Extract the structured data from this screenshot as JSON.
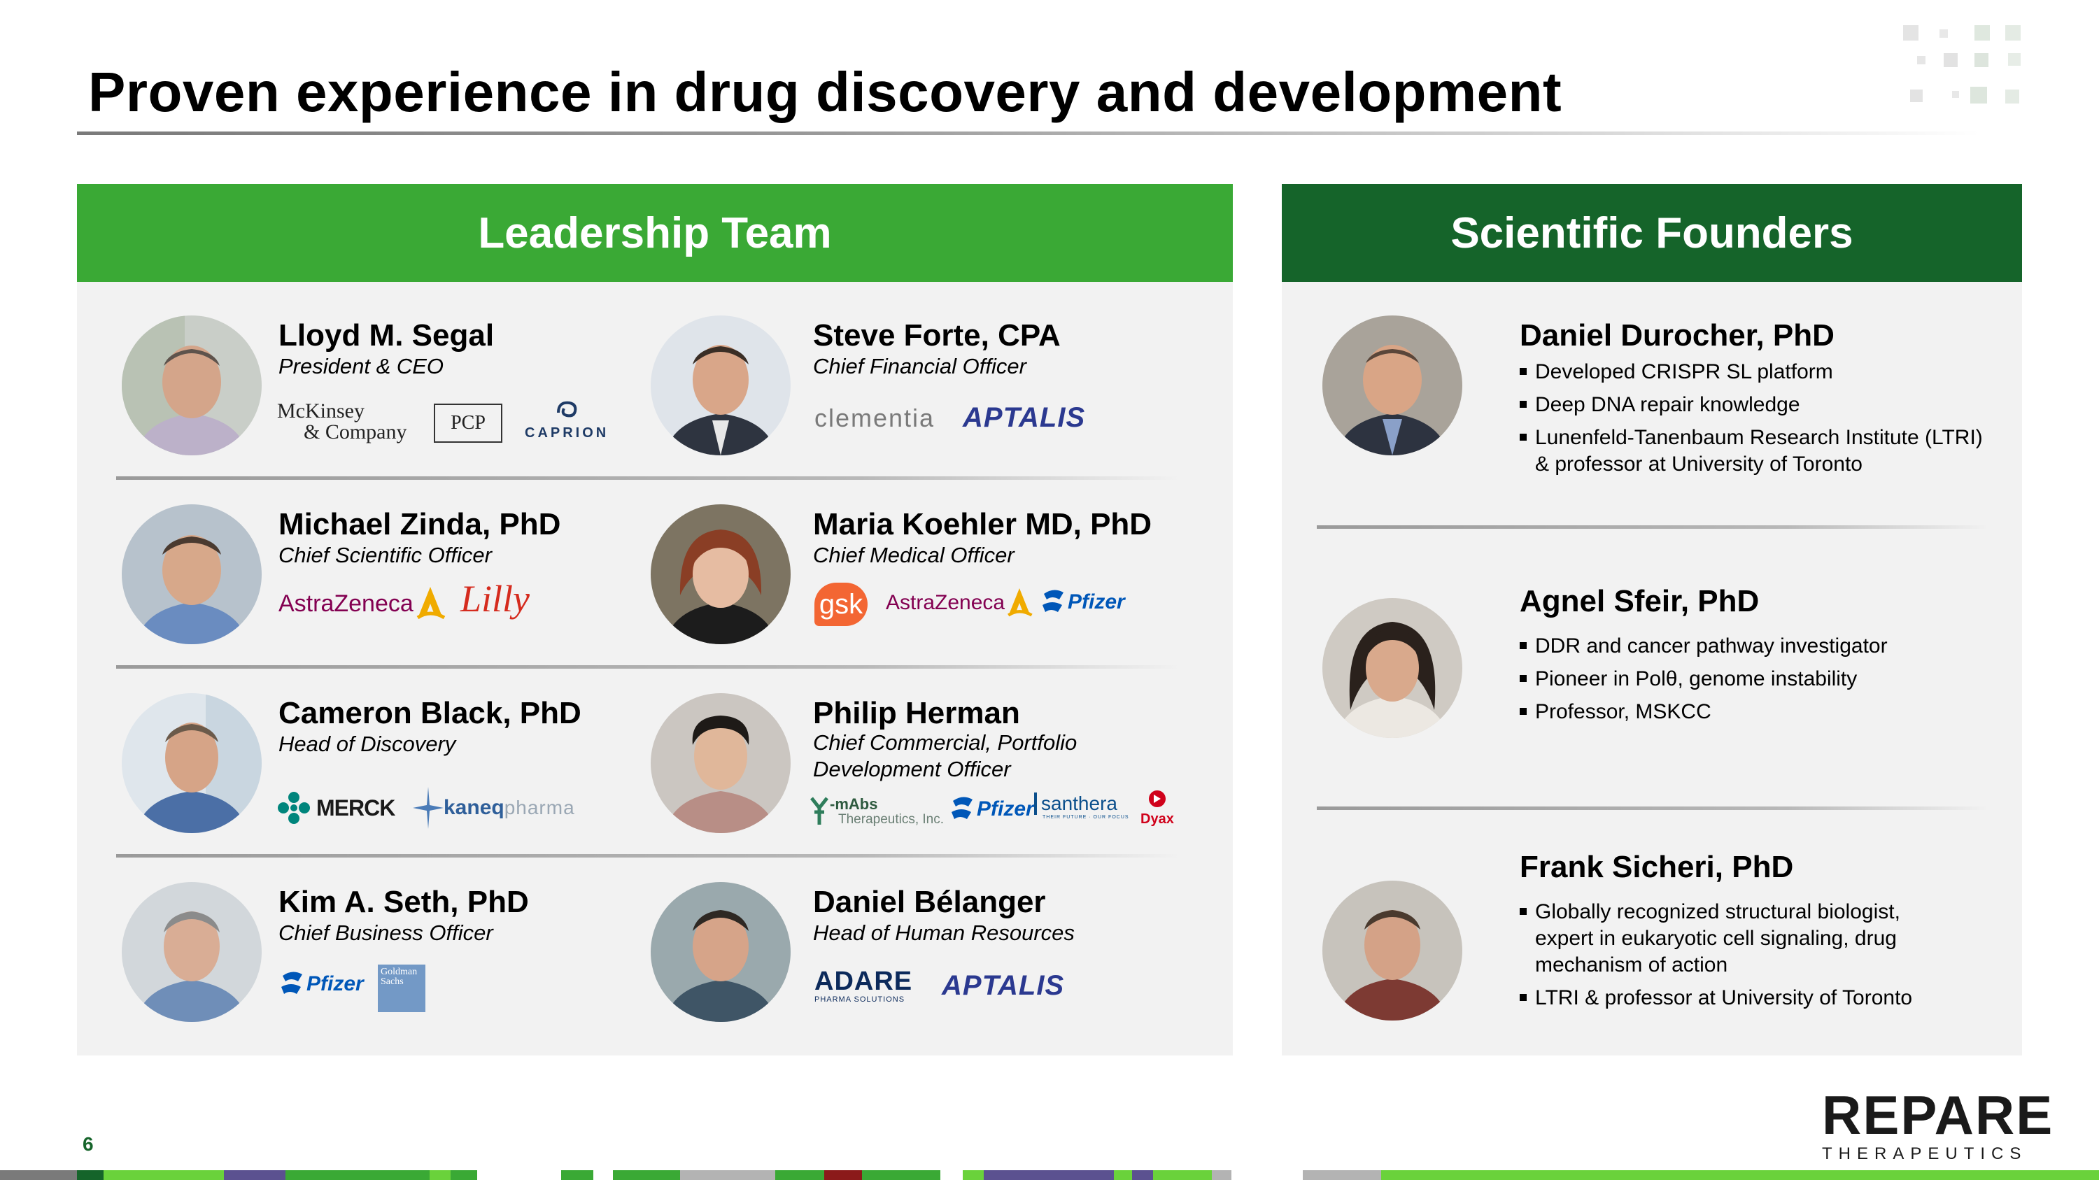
{
  "title": "Proven experience in drug discovery and development",
  "leadership": {
    "heading": "Leadership Team",
    "people": [
      {
        "name": "Lloyd M. Segal",
        "role": "President & CEO",
        "logos": [
          "McKinsey & Company",
          "PCP",
          "CAPRION"
        ]
      },
      {
        "name": "Steve Forte, CPA",
        "role": "Chief Financial Officer",
        "logos": [
          "clementia",
          "APTALIS"
        ]
      },
      {
        "name": "Michael Zinda, PhD",
        "role": "Chief Scientific Officer",
        "logos": [
          "AstraZeneca",
          "Lilly"
        ]
      },
      {
        "name": "Maria Koehler MD, PhD",
        "role": "Chief Medical Officer",
        "logos": [
          "gsk",
          "AstraZeneca",
          "Pfizer"
        ]
      },
      {
        "name": "Cameron Black, PhD",
        "role": "Head of Discovery",
        "logos": [
          "MERCK",
          "kaneqpharma"
        ]
      },
      {
        "name": "Philip Herman",
        "role": "Chief Commercial, Portfolio Development Officer",
        "logos": [
          "mAbs Therapeutics, Inc.",
          "Pfizer",
          "santhera",
          "Dyax"
        ]
      },
      {
        "name": "Kim A. Seth, PhD",
        "role": "Chief Business Officer",
        "logos": [
          "Pfizer",
          "Goldman Sachs"
        ]
      },
      {
        "name": "Daniel Bélanger",
        "role": "Head of Human Resources",
        "logos": [
          "ADARE",
          "APTALIS"
        ]
      }
    ]
  },
  "founders": {
    "heading": "Scientific Founders",
    "people": [
      {
        "name": "Daniel Durocher, PhD",
        "bullets": [
          "Developed CRISPR SL platform",
          "Deep DNA repair knowledge",
          "Lunenfeld-Tanenbaum Research Institute (LTRI) & professor at University of Toronto"
        ]
      },
      {
        "name": "Agnel Sfeir, PhD",
        "bullets": [
          "DDR and cancer pathway investigator",
          "Pioneer in Polθ, genome instability",
          "Professor, MSKCC"
        ]
      },
      {
        "name": "Frank Sicheri, PhD",
        "bullets": [
          "Globally recognized structural biologist, expert in eukaryotic cell signaling, drug mechanism of action",
          "LTRI & professor at University of Toronto"
        ]
      }
    ]
  },
  "logo_text": {
    "mckinsey_1": "McKinsey",
    "mckinsey_2": "& Company",
    "pcp": "PCP",
    "caprion": "CAPRION",
    "clementia": "clementia",
    "aptalis": "APTALIS",
    "astrazeneca": "AstraZeneca",
    "lilly": "Lilly",
    "gsk": "gsk",
    "pfizer": "Pfizer",
    "merck": "MERCK",
    "kaneq_1": "kaneq",
    "kaneq_2": "pharma",
    "mabs_1": "-mAbs",
    "mabs_2": "Therapeutics, Inc.",
    "santhera": "santhera",
    "santhera_tag": "THEIR FUTURE · OUR FOCUS",
    "dyax": "Dyax",
    "goldman": "Goldman Sachs",
    "adare_1": "ADARE",
    "adare_2": "PHARMA SOLUTIONS"
  },
  "page_number": "6",
  "brand": {
    "name": "REPARE",
    "sub": "THERAPEUTICS"
  },
  "colors": {
    "green_bright": "#3aa935",
    "green_dark": "#15642a",
    "panel_bg": "#f2f2f2",
    "aptalis_blue": "#2b3990",
    "astrazeneca_purple": "#830051",
    "lilly_red": "#d52b1e",
    "pfizer_blue": "#0057b8",
    "merck_teal": "#00857c"
  }
}
